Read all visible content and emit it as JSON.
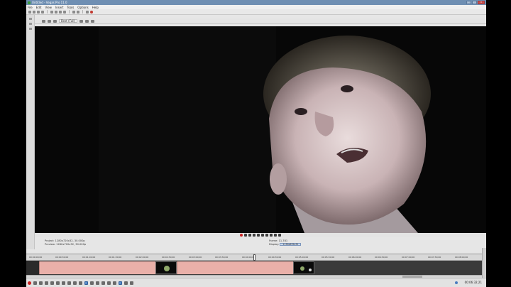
{
  "window": {
    "title": "Untitled - Vegas Pro 11.0",
    "buttons": {
      "minimize": "–",
      "maximize": "□",
      "close": "✕"
    }
  },
  "menu": [
    "File",
    "Edit",
    "View",
    "Insert",
    "Tools",
    "Options",
    "Help"
  ],
  "preview": {
    "quality": "Best (Full)",
    "project_label": "Project:",
    "project_value": "1280x720x32, 30.000p",
    "preview_label": "Preview:",
    "preview_value": "1280x720x32, 30.000p",
    "frame_label": "Frame:",
    "frame_value": "11,781",
    "display_label": "Display:",
    "display_value": "1136x639x32"
  },
  "ruler_ticks": [
    "00:00:00;00",
    "00:00:30;00",
    "00:01:00;00",
    "00:01:30;00",
    "00:02:00;00",
    "00:02:30;00",
    "00:03:00;00",
    "00:03:30;00",
    "00:04:00;00",
    "00:04:30;00",
    "00:05:00;00",
    "00:05:30;00",
    "00:06:00;00",
    "00:06:30;00",
    "00:07:00;00",
    "00:07:30;00",
    "00:08:00;00"
  ],
  "timeline": {
    "timecode": "00:06:32;21"
  },
  "colors": {
    "titlebar": "#6f8fb3",
    "clip": "#e9b0a9",
    "record": "#cc2222",
    "video_bg": "#050505"
  }
}
